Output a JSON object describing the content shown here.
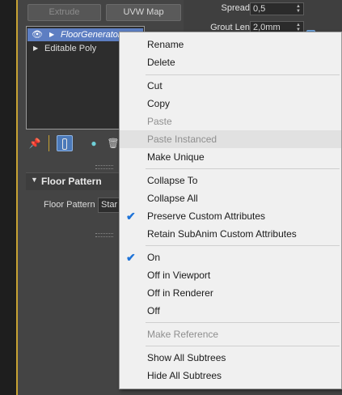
{
  "colors": {
    "accent": "#4b79b9",
    "selected_row": "#5d7ec2",
    "viewport_border": "#c7a233",
    "menu_bg": "#f0f0f0",
    "check": "#1e73d8"
  },
  "top_buttons": {
    "extrude": "Extrude",
    "uvw_map": "UVW Map"
  },
  "params": {
    "spread_label": "Spread",
    "spread_value": "0,5",
    "grout_len_label": "Grout Len",
    "grout_len_value": "2,0mm"
  },
  "modifier_stack": {
    "items": [
      {
        "label": "FloorGenerator",
        "visible_icon": "eye-icon",
        "selected": true
      },
      {
        "label": "Editable Poly",
        "selected": false
      }
    ]
  },
  "stack_toolbar": {
    "icons": [
      "pin-stack-icon",
      "show-end-result-icon",
      "make-unique-icon",
      "remove-modifier-icon"
    ]
  },
  "rollout": {
    "title": "Floor Pattern",
    "field_label": "Floor Pattern",
    "field_value": "Star"
  },
  "context_menu": {
    "items": [
      {
        "label": "Rename",
        "enabled": true
      },
      {
        "label": "Delete",
        "enabled": true
      },
      {
        "label": "Cut",
        "enabled": true
      },
      {
        "label": "Copy",
        "enabled": true
      },
      {
        "label": "Paste",
        "enabled": false
      },
      {
        "label": "Paste Instanced",
        "enabled": false,
        "hovered": true
      },
      {
        "label": "Make Unique",
        "enabled": true
      },
      {
        "label": "Collapse To",
        "enabled": true
      },
      {
        "label": "Collapse All",
        "enabled": true
      },
      {
        "label": "Preserve Custom Attributes",
        "enabled": true,
        "checked": true
      },
      {
        "label": "Retain SubAnim Custom Attributes",
        "enabled": true
      },
      {
        "label": "On",
        "enabled": true,
        "checked": true
      },
      {
        "label": "Off in Viewport",
        "enabled": true
      },
      {
        "label": "Off in Renderer",
        "enabled": true
      },
      {
        "label": "Off",
        "enabled": true
      },
      {
        "label": "Make Reference",
        "enabled": false
      },
      {
        "label": "Show All Subtrees",
        "enabled": true
      },
      {
        "label": "Hide All Subtrees",
        "enabled": true
      }
    ]
  }
}
